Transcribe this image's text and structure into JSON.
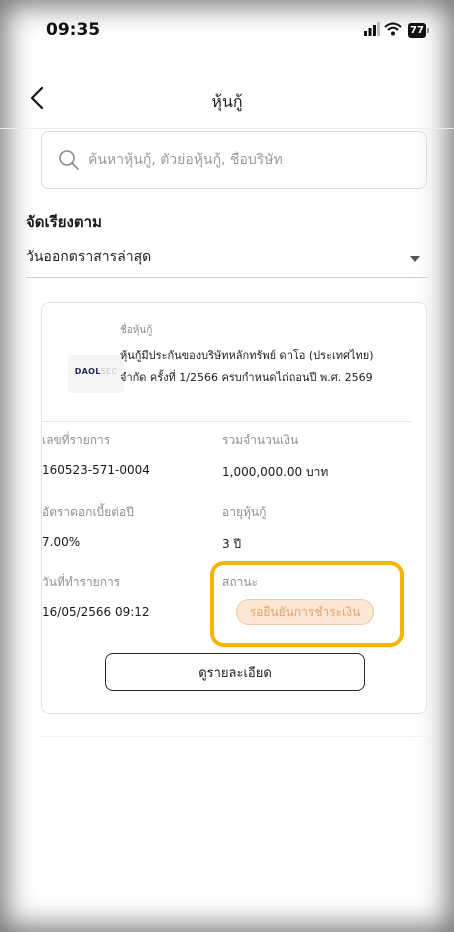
{
  "status_bar": {
    "time": "09:35",
    "battery": "77"
  },
  "nav": {
    "title": "หุ้นกู้"
  },
  "search": {
    "placeholder": "ค้นหาหุ้นกู้, ตัวย่อหุ้นกู้, ชื่อบริษัท"
  },
  "sort": {
    "label": "จัดเรียงตาม",
    "selected": "วันออกตราสารล่าสุด"
  },
  "card": {
    "logo": {
      "main": "DAOL",
      "suffix": "SEC"
    },
    "bond_name_label": "ชื่อหุ้นกู้",
    "bond_name": "หุ้นกู้มีประกันของบริษัทหลักทรัพย์ ดาโอ (ประเทศไทย) จำกัด ครั้งที่ 1/2566 ครบกำหนดไถ่ถอนปี พ.ศ. 2569",
    "txn_no_label": "เลขที่รายการ",
    "txn_no": "160523-571-0004",
    "total_label": "รวมจำนวนเงิน",
    "total": "1,000,000.00 บาท",
    "rate_label": "อัตราดอกเบี้ยต่อปี",
    "rate": "7.00%",
    "term_label": "อายุหุ้นกู้",
    "term": "3 ปี",
    "date_label": "วันที่ทำรายการ",
    "date": "16/05/2566 09:12",
    "status_label": "สถานะ",
    "status": "รอยืนยันการชำระเงิน",
    "details_button": "ดูรายละเอียด"
  },
  "colors": {
    "highlight": "#f7b500",
    "badge_bg": "#fbe7d3",
    "badge_text": "#e6a16a"
  }
}
